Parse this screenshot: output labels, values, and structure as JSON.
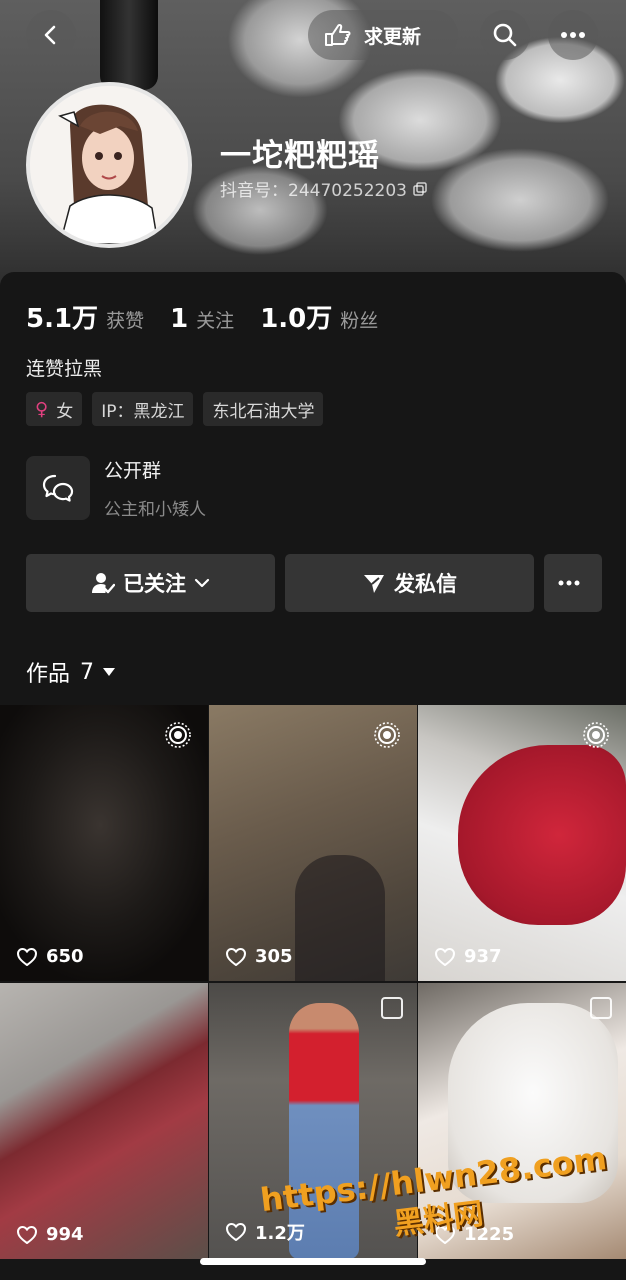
{
  "header": {
    "request_update_label": "求更新",
    "nickname": "一坨粑粑瑶",
    "douyin_id": "抖音号：24470252203"
  },
  "stats": [
    {
      "value": "5.1万",
      "label": "获赞"
    },
    {
      "value": "1",
      "label": "关注"
    },
    {
      "value": "1.0万",
      "label": "粉丝"
    }
  ],
  "bio": "连赞拉黑",
  "tags": {
    "gender": "女",
    "ip": "IP：黑龙江",
    "school": "东北石油大学"
  },
  "group": {
    "title": "公开群",
    "subtitle": "公主和小矮人"
  },
  "actions": {
    "follow_label": "已关注",
    "message_label": "发私信"
  },
  "works": {
    "label": "作品",
    "count": "7"
  },
  "videos": [
    {
      "likes": "650",
      "badge": "live-icon"
    },
    {
      "likes": "305",
      "badge": "live-icon"
    },
    {
      "likes": "937",
      "badge": "live-icon"
    },
    {
      "likes": "994",
      "badge": "none"
    },
    {
      "likes": "1.2万",
      "badge": "select-box"
    },
    {
      "likes": "1225",
      "badge": "select-box"
    }
  ],
  "watermark": {
    "url": "https://hlwn28.com",
    "name": "黑料网"
  },
  "colors": {
    "background": "#161616",
    "button": "#353535",
    "tag_bg": "#2a2a2a",
    "gender_accent": "#e0407f",
    "watermark": "#f0a020"
  }
}
